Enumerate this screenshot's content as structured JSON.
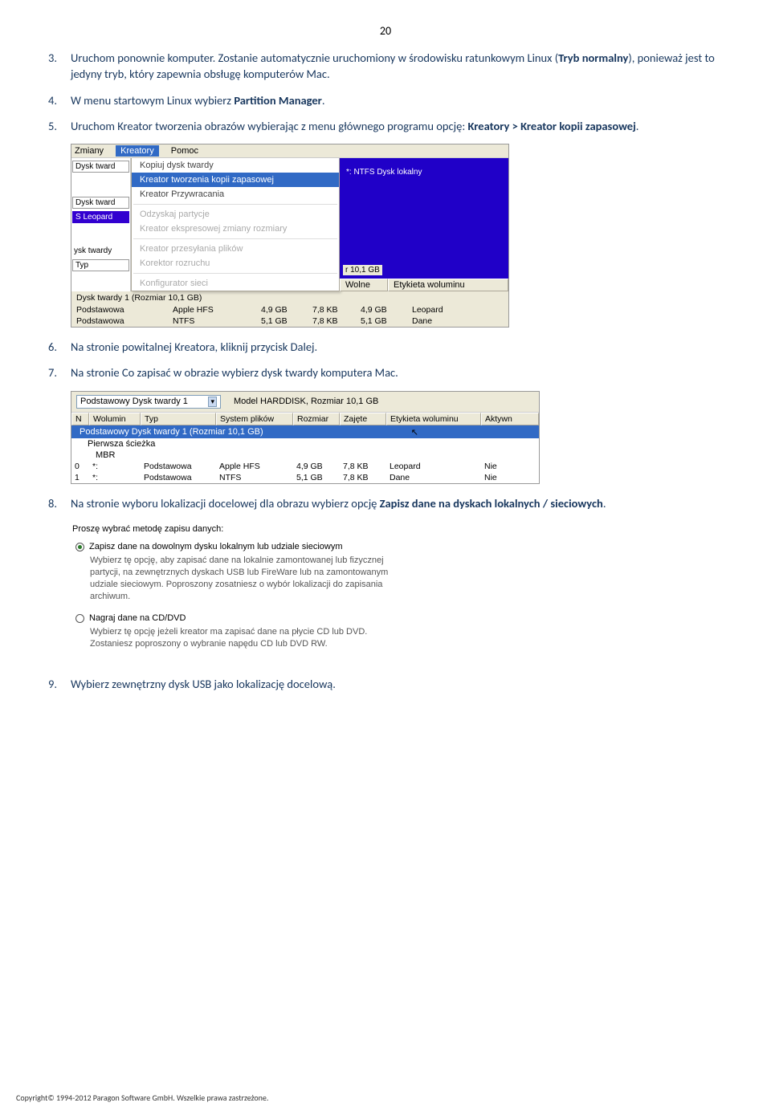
{
  "page_num": "20",
  "steps": {
    "3": {
      "text_a": "Uruchom ponownie komputer. Zostanie automatycznie uruchomiony w środowisku ratunkowym Linux (",
      "bold_a": "Tryb normalny",
      "text_b": "), ponieważ jest to jedyny tryb, który zapewnia obsługę komputerów Mac."
    },
    "4": {
      "text_a": "W menu startowym Linux wybierz ",
      "bold_a": "Partition Manager",
      "text_b": "."
    },
    "5": {
      "text_a": "Uruchom Kreator tworzenia obrazów wybierając z menu głównego programu opcję: ",
      "bold_a": "Kreatory > Kreator kopii zapasowej",
      "text_b": "."
    },
    "6": {
      "text_a": "Na stronie powitalnej Kreatora, kliknij przycisk Dalej."
    },
    "7": {
      "text_a": "Na stronie Co zapisać w obrazie wybierz dysk twardy komputera Mac."
    },
    "8": {
      "text_a": "Na stronie wyboru lokalizacji docelowej dla obrazu wybierz opcję ",
      "bold_a": "Zapisz dane na dyskach lokalnych / sieciowych",
      "text_b": "."
    },
    "9": {
      "text_a": "Wybierz zewnętrzny dysk USB jako lokalizację docelową."
    }
  },
  "sc1": {
    "menubar": {
      "zmiany": "Zmiany",
      "kreatory": "Kreatory",
      "pomoc": "Pomoc"
    },
    "left": {
      "dysk1": "Dysk tward",
      "dysk2": "Dysk tward",
      "leopard": "S  Leopard",
      "ysk": "ysk twardy",
      "typ": "Typ"
    },
    "menu": {
      "m1": "Kopiuj dysk twardy",
      "m2": "Kreator tworzenia kopii zapasowej",
      "m3": "Kreator Przywracania",
      "m4": "Odzyskaj partycje",
      "m5": "Kreator ekspresowej zmiany rozmiary",
      "m6": "Kreator przesyłania plików",
      "m7": "Korektor rozruchu",
      "m8": "Konfigurator sieci"
    },
    "right_lbl": "*:  NTFS  Dysk lokalny",
    "right_size": "r 10,1 GB",
    "hdr": {
      "wolne": "Wolne",
      "et": "Etykieta woluminu"
    },
    "title": "Dysk twardy 1 (Rozmiar 10,1 GB)",
    "rows": [
      {
        "a": "Podstawowa",
        "b": "Apple HFS",
        "c": "4,9 GB",
        "d": "7,8 KB",
        "e": "4,9 GB",
        "f": "Leopard"
      },
      {
        "a": "Podstawowa",
        "b": "NTFS",
        "c": "5,1 GB",
        "d": "7,8 KB",
        "e": "5,1 GB",
        "f": "Dane"
      }
    ]
  },
  "sc2": {
    "select": "Podstawowy Dysk twardy 1",
    "model": "Model HARDDISK, Rozmiar 10,1 GB",
    "hdr": {
      "n": "N",
      "w": "Wolumin",
      "t": "Typ",
      "s": "System plików",
      "r": "Rozmiar",
      "z": "Zajęte",
      "e": "Etykieta woluminu",
      "a": "Aktywn"
    },
    "title": "Podstawowy Dysk twardy 1 (Rozmiar 10,1 GB)",
    "sub1": "Pierwsza ścieżka",
    "sub2": "MBR",
    "rows": [
      {
        "n": "0",
        "w": "*:",
        "t": "Podstawowa",
        "s": "Apple HFS",
        "r": "4,9 GB",
        "z": "7,8 KB",
        "e": "Leopard",
        "a": "Nie"
      },
      {
        "n": "1",
        "w": "*:",
        "t": "Podstawowa",
        "s": "NTFS",
        "r": "5,1 GB",
        "z": "7,8 KB",
        "e": "Dane",
        "a": "Nie"
      }
    ]
  },
  "sc3": {
    "heading": "Proszę wybrać metodę zapisu danych:",
    "opt1": "Zapisz dane na dowolnym dysku lokalnym lub udziale sieciowym",
    "desc1": "Wybierz tę opcję, aby zapisać dane na lokalnie zamontowanej lub fizycznej partycji, na zewnętrznych dyskach USB lub FireWare lub na zamontowanym udziale sieciowym. Poproszony zosatniesz o wybór lokalizacji do zapisania archiwum.",
    "opt2": "Nagraj dane na CD/DVD",
    "desc2": "Wybierz tę opcję jeżeli kreator ma zapisać dane na płycie CD lub DVD. Zostaniesz poproszony o wybranie napędu CD lub DVD RW."
  },
  "footer": "Copyright© 1994-2012 Paragon Software GmbH. Wszelkie prawa zastrzeżone."
}
